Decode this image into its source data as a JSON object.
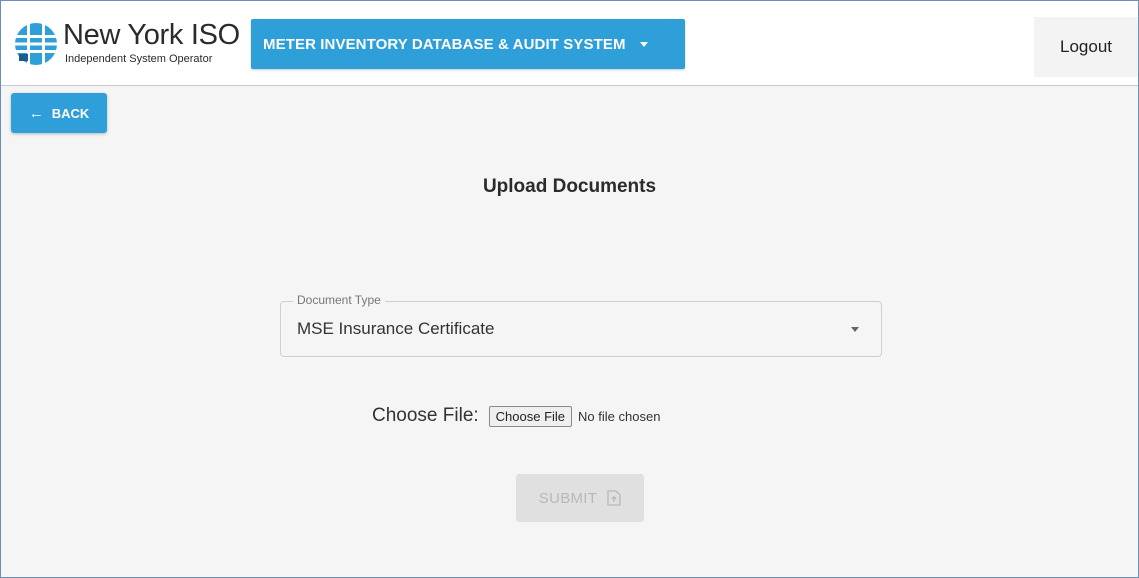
{
  "header": {
    "logo": {
      "name": "New York ISO",
      "subtitle": "Independent System Operator",
      "icon": "nyiso-globe-icon"
    },
    "app_menu": {
      "label": "METER INVENTORY DATABASE & AUDIT SYSTEM",
      "icon": "caret-down-icon"
    },
    "logout_label": "Logout"
  },
  "back_button": {
    "label": "BACK",
    "icon": "arrow-left-icon"
  },
  "page_title": "Upload Documents",
  "form": {
    "document_type": {
      "label": "Document Type",
      "value": "MSE Insurance Certificate",
      "icon": "caret-down-icon"
    },
    "file": {
      "label": "Choose File:",
      "button_label": "Choose File",
      "status": "No file chosen"
    },
    "submit": {
      "label": "SUBMIT",
      "icon": "file-upload-icon",
      "disabled": true
    }
  },
  "colors": {
    "accent": "#2e9fd8",
    "background": "#f5f5f5",
    "disabled": "#e0e0e0"
  }
}
